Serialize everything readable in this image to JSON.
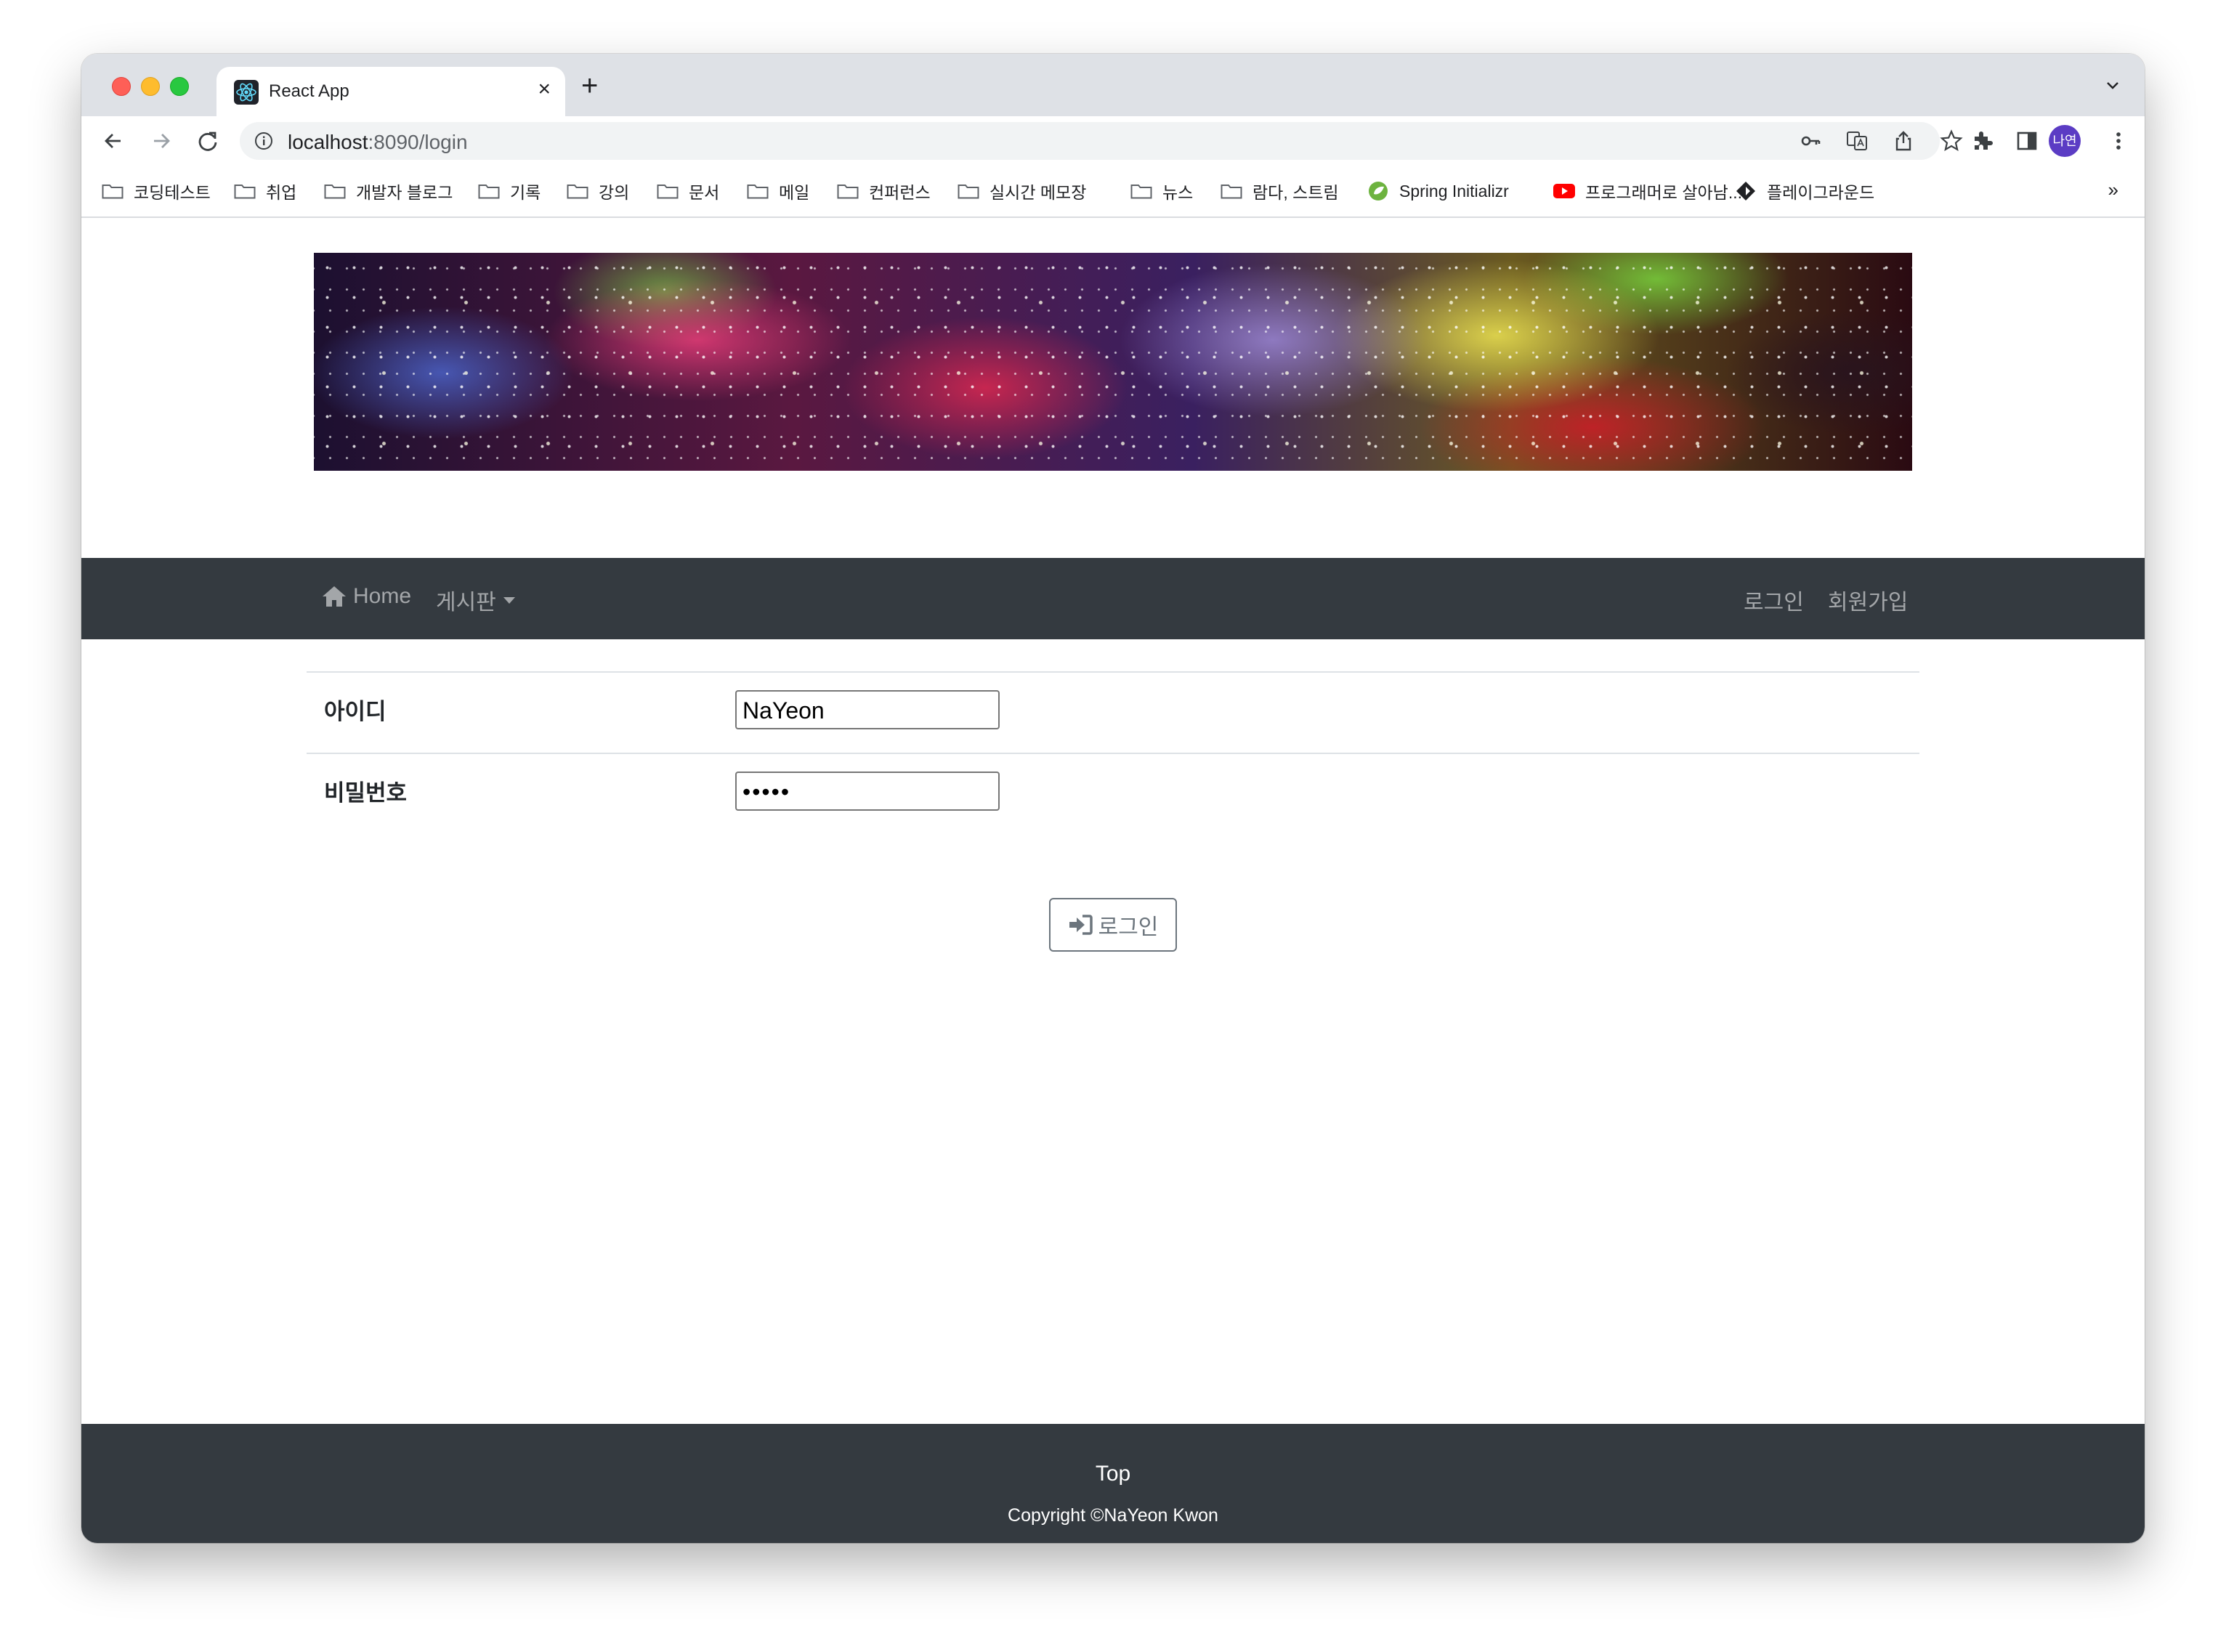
{
  "browser": {
    "tab_title": "React App",
    "new_tab_symbol": "+",
    "close_symbol": "×",
    "url_host": "localhost",
    "url_path": ":8090/login",
    "profile_initials": "나연"
  },
  "bookmarks": [
    {
      "label": "코딩테스트",
      "icon": "folder-icon"
    },
    {
      "label": "취업",
      "icon": "folder-icon"
    },
    {
      "label": "개발자 블로그",
      "icon": "folder-icon"
    },
    {
      "label": "기록",
      "icon": "folder-icon"
    },
    {
      "label": "강의",
      "icon": "folder-icon"
    },
    {
      "label": "문서",
      "icon": "folder-icon"
    },
    {
      "label": "메일",
      "icon": "folder-icon"
    },
    {
      "label": "컨퍼런스",
      "icon": "folder-icon"
    },
    {
      "label": "실시간 메모장",
      "icon": "folder-icon"
    },
    {
      "label": "뉴스",
      "icon": "folder-icon"
    },
    {
      "label": "람다, 스트림",
      "icon": "folder-icon"
    },
    {
      "label": "Spring Initializr",
      "icon": "spring-icon"
    },
    {
      "label": "프로그래머로 살아남...",
      "icon": "youtube-icon"
    },
    {
      "label": "플레이그라운드",
      "icon": "diamond-icon"
    }
  ],
  "bookmarks_more": "»",
  "navbar": {
    "home": "Home",
    "board": "게시판",
    "login": "로그인",
    "signup": "회원가입"
  },
  "form": {
    "id_label": "아이디",
    "id_value": "NaYeon",
    "password_label": "비밀번호",
    "password_value": "•••••",
    "login_button": "로그인"
  },
  "footer": {
    "top_link": "Top",
    "copyright": "Copyright ©NaYeon Kwon"
  },
  "colors": {
    "navbar_bg": "#343a40",
    "nav_link": "rgba(255,255,255,0.55)",
    "button_border": "#6c757d"
  }
}
